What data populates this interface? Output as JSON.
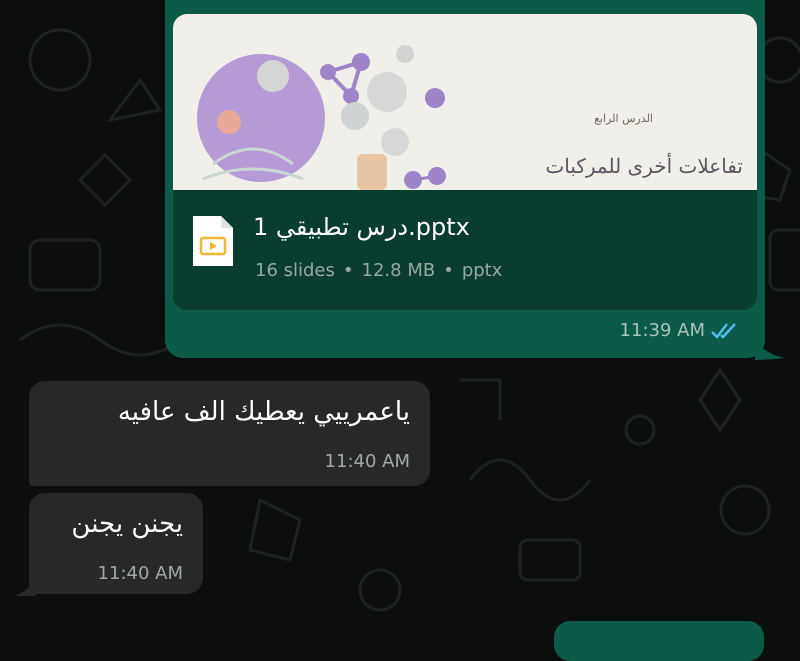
{
  "outgoing_document": {
    "preview_subtitle": "الدرس الرابع",
    "preview_title": "تفاعلات أخرى للمركبات",
    "file_name": "درس تطبيقي 1.pptx",
    "slides": "16 slides",
    "size": "12.8 MB",
    "type": "pptx",
    "separator": "•",
    "time": "11:39 AM",
    "status_icon": "double-check-read-icon"
  },
  "incoming_messages": [
    {
      "text": "ياعمرييي يعطيك الف عافيه",
      "time": "11:40 AM"
    },
    {
      "text": "يجنن يجنن",
      "time": "11:40 AM"
    }
  ],
  "colors": {
    "background": "#0c0e0d",
    "outgoing_bubble": "#0c5b49",
    "document_card": "#083d30",
    "incoming_bubble": "#272929",
    "read_ticks": "#53bdeb",
    "slide_purple": "#b59ad6"
  }
}
